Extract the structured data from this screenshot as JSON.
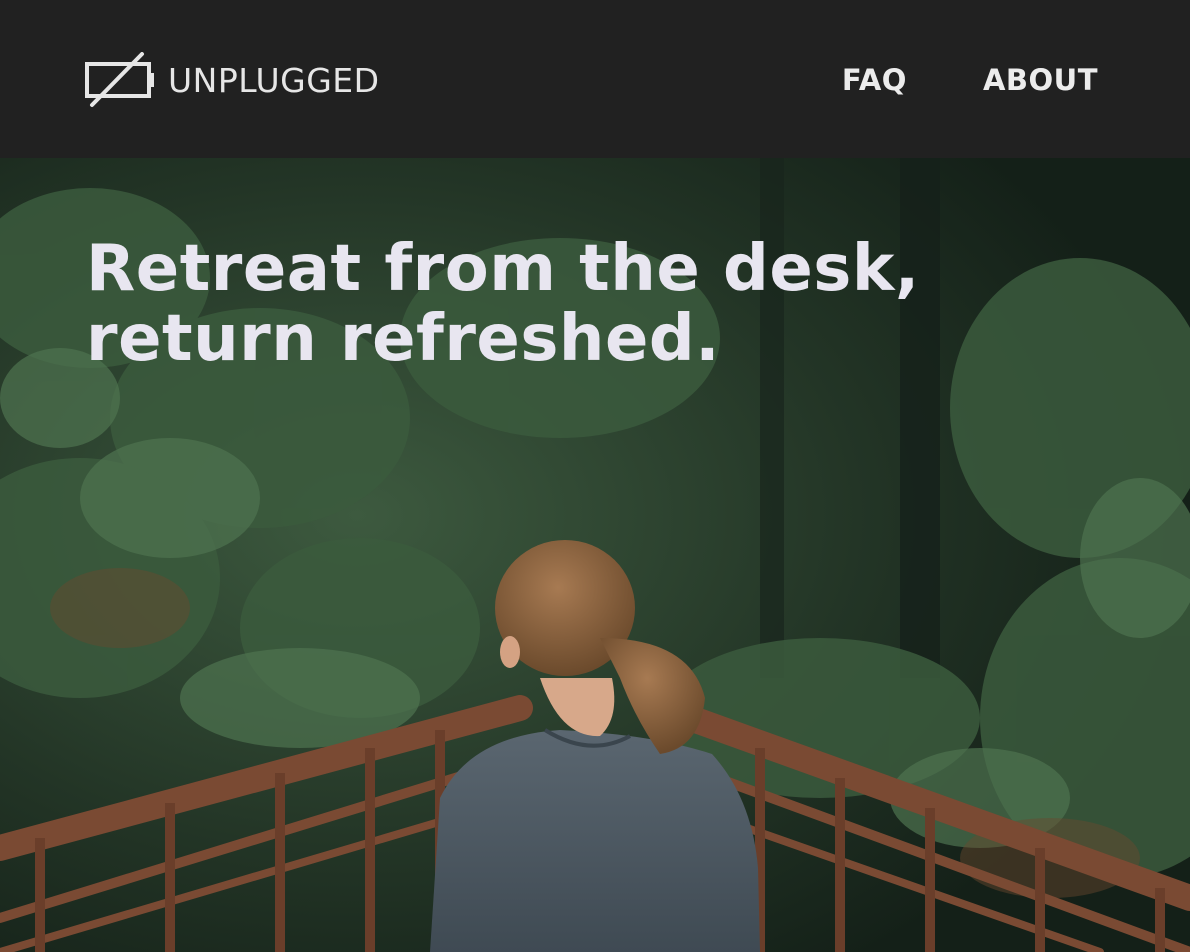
{
  "header": {
    "logo_text": "UNPLUGGED",
    "logo_icon": "battery-slash-icon",
    "nav": [
      {
        "label": "FAQ"
      },
      {
        "label": "ABOUT"
      }
    ]
  },
  "hero": {
    "headline_line1": "Retreat from the desk,",
    "headline_line2": "return refreshed."
  },
  "colors": {
    "header_bg": "#212121",
    "text_light": "#e8e6f0",
    "forest_dark": "#1b2a1e"
  }
}
